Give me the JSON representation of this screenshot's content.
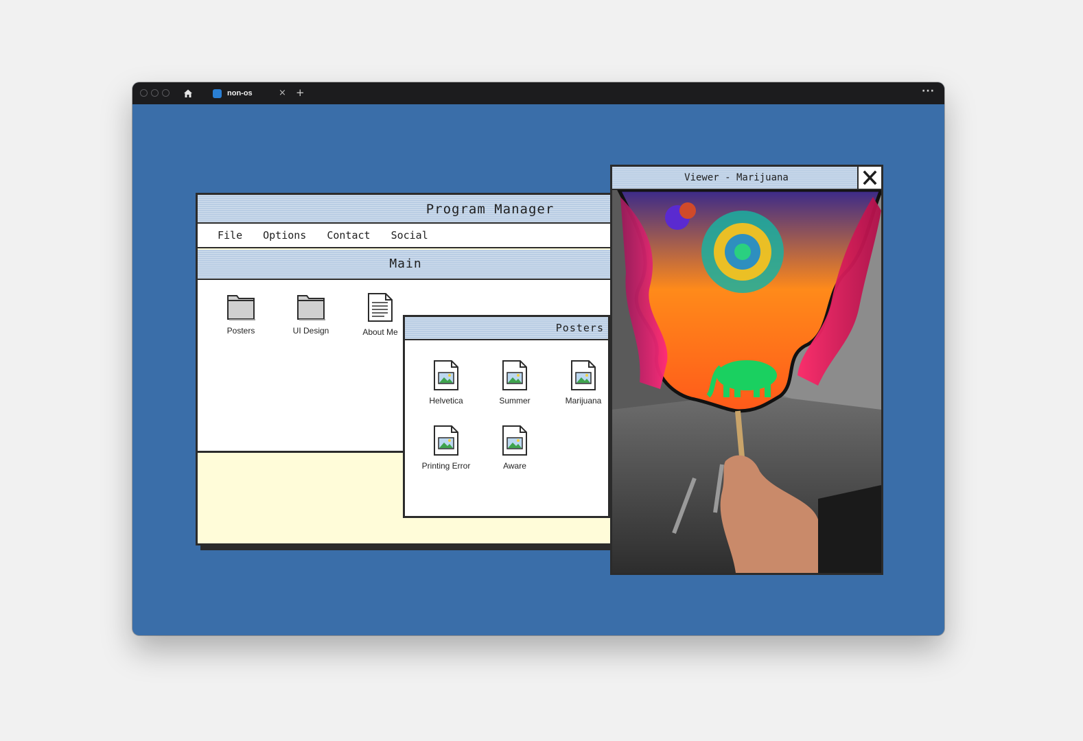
{
  "browser": {
    "tab_title": "non-os",
    "tab_close": "×",
    "new_tab": "+",
    "menu": "···"
  },
  "program_manager": {
    "title": "Program Manager",
    "menu": [
      "File",
      "Options",
      "Contact",
      "Social"
    ]
  },
  "main": {
    "title": "Main",
    "items": [
      {
        "label": "Posters",
        "icon": "folder-icon"
      },
      {
        "label": "UI Design",
        "icon": "folder-icon"
      },
      {
        "label": "About Me",
        "icon": "document-icon"
      }
    ]
  },
  "posters": {
    "title": "Posters",
    "items": [
      {
        "label": "Helvetica",
        "icon": "image-file-icon"
      },
      {
        "label": "Summer",
        "icon": "image-file-icon"
      },
      {
        "label": "Marijuana",
        "icon": "image-file-icon"
      },
      {
        "label": "Printing Error",
        "icon": "image-file-icon"
      },
      {
        "label": "Aware",
        "icon": "image-file-icon"
      }
    ]
  },
  "viewer": {
    "title": "Viewer - Marijuana",
    "close_icon": "close-icon"
  },
  "colors": {
    "desktop": "#3a6ea9",
    "titlebar": "#b9cde4",
    "status_area": "#fffcd9",
    "border": "#2b2b2b"
  }
}
